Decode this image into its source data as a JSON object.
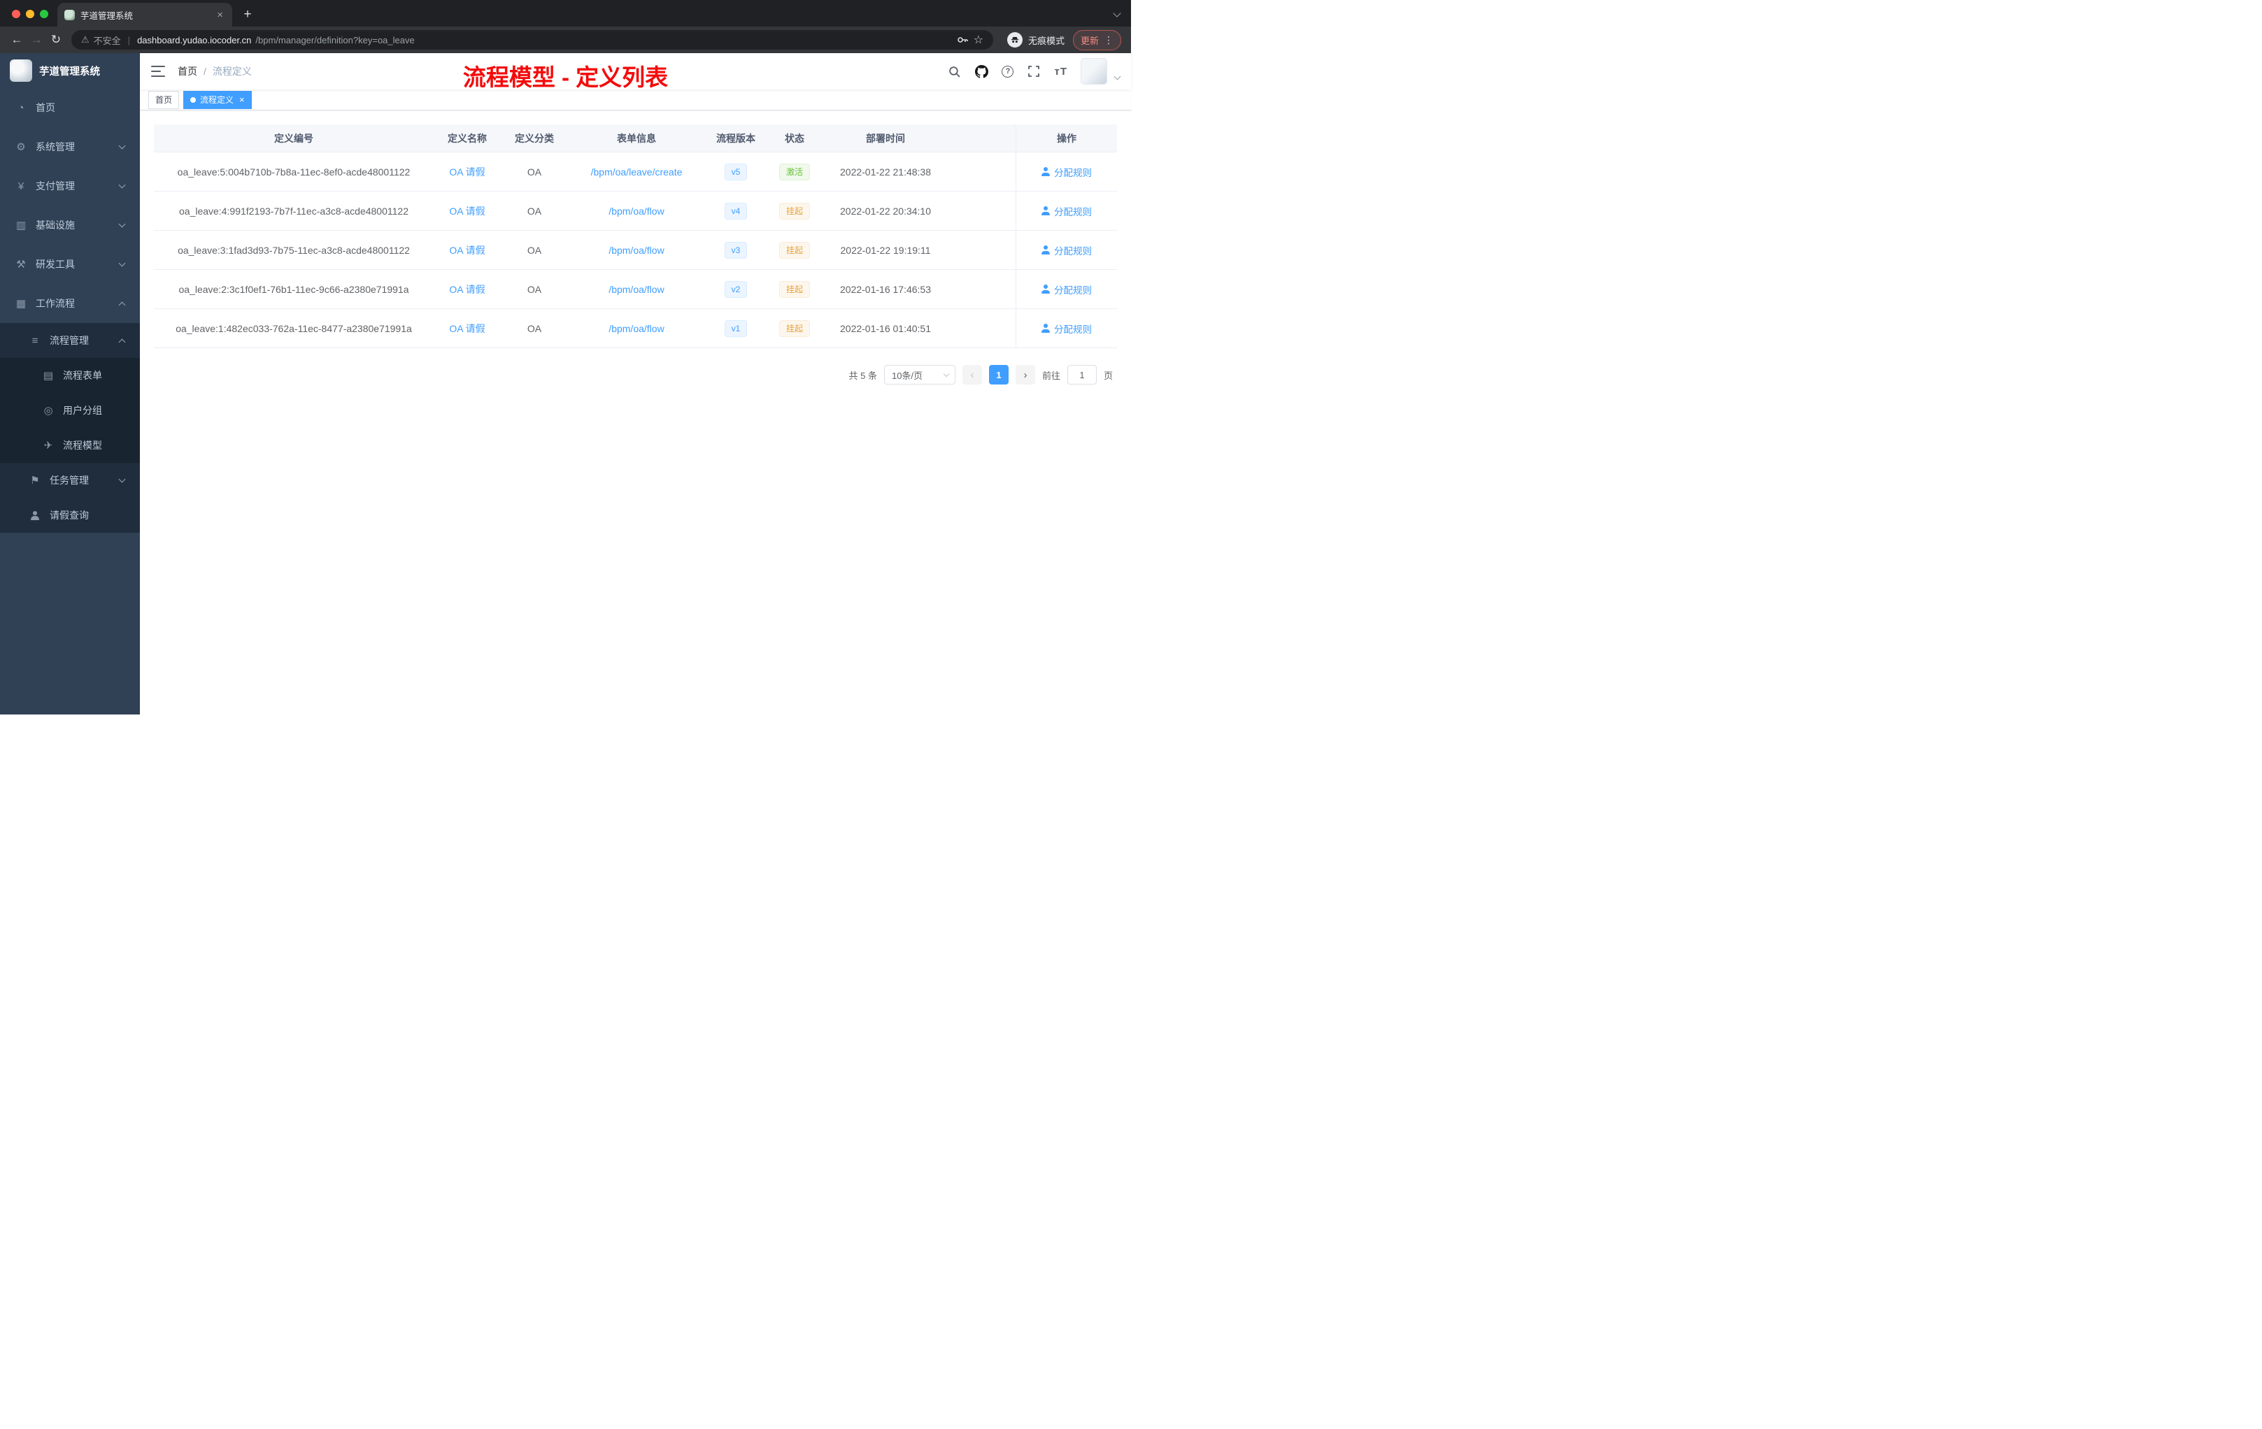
{
  "colors": {
    "accent": "#409eff",
    "success": "#67c23a",
    "warning": "#e6a23c",
    "annotation_red": "#f40b0b",
    "sidebar_bg": "#304156"
  },
  "browser": {
    "tab_title": "芋道管理系统",
    "security_label": "不安全",
    "url_host": "dashboard.yudao.iocoder.cn",
    "url_path": "/bpm/manager/definition?key=oa_leave",
    "incognito_label": "无痕模式",
    "update_label": "更新"
  },
  "sidebar": {
    "logo_title": "芋道管理系统",
    "items": [
      {
        "key": "home",
        "label": "首页",
        "icon": "dashboard",
        "glyph": "◔",
        "level": 1
      },
      {
        "key": "system",
        "label": "系统管理",
        "icon": "gear",
        "glyph": "⚙",
        "level": 1,
        "chevron": "down"
      },
      {
        "key": "payment",
        "label": "支付管理",
        "icon": "yen",
        "glyph": "¥",
        "level": 1,
        "chevron": "down"
      },
      {
        "key": "infrastructure",
        "label": "基础设施",
        "icon": "monitor",
        "glyph": "▥",
        "level": 1,
        "chevron": "down"
      },
      {
        "key": "devtools",
        "label": "研发工具",
        "icon": "tools",
        "glyph": "⚒",
        "level": 1,
        "chevron": "down"
      },
      {
        "key": "workflow",
        "label": "工作流程",
        "icon": "cube",
        "glyph": "▦",
        "level": 1,
        "chevron": "up"
      },
      {
        "key": "process-mgmt",
        "label": "流程管理",
        "icon": "list",
        "glyph": "≡",
        "level": 2,
        "chevron": "up"
      },
      {
        "key": "process-form",
        "label": "流程表单",
        "icon": "document",
        "glyph": "▤",
        "level": 3
      },
      {
        "key": "user-group",
        "label": "用户分组",
        "icon": "users",
        "glyph": "◎",
        "level": 3
      },
      {
        "key": "process-model",
        "label": "流程模型",
        "icon": "send",
        "glyph": "✈",
        "level": 3
      },
      {
        "key": "task-mgmt",
        "label": "任务管理",
        "icon": "task",
        "glyph": "⚑",
        "level": 2,
        "chevron": "down"
      },
      {
        "key": "leave-query",
        "label": "请假查询",
        "icon": "person",
        "glyph": "person",
        "level": 2
      }
    ]
  },
  "navbar": {
    "breadcrumb_home": "首页",
    "breadcrumb_sep": "/",
    "breadcrumb_current": "流程定义",
    "font_icon_text": "тT",
    "annotation": "流程模型 - 定义列表"
  },
  "tags": [
    {
      "label": "首页",
      "active": false,
      "closable": false
    },
    {
      "label": "流程定义",
      "active": true,
      "closable": true
    }
  ],
  "table": {
    "columns": [
      "定义编号",
      "定义名称",
      "定义分类",
      "表单信息",
      "流程版本",
      "状态",
      "部署时间",
      "操作"
    ],
    "rows": [
      {
        "id": "oa_leave:5:004b710b-7b8a-11ec-8ef0-acde48001122",
        "name": "OA 请假",
        "category": "OA",
        "form": "/bpm/oa/leave/create",
        "version": "v5",
        "status": "激活",
        "status_type": "success",
        "time": "2022-01-22 21:48:38",
        "action": "分配规则"
      },
      {
        "id": "oa_leave:4:991f2193-7b7f-11ec-a3c8-acde48001122",
        "name": "OA 请假",
        "category": "OA",
        "form": "/bpm/oa/flow",
        "version": "v4",
        "status": "挂起",
        "status_type": "warning",
        "time": "2022-01-22 20:34:10",
        "action": "分配规则"
      },
      {
        "id": "oa_leave:3:1fad3d93-7b75-11ec-a3c8-acde48001122",
        "name": "OA 请假",
        "category": "OA",
        "form": "/bpm/oa/flow",
        "version": "v3",
        "status": "挂起",
        "status_type": "warning",
        "time": "2022-01-22 19:19:11",
        "action": "分配规则"
      },
      {
        "id": "oa_leave:2:3c1f0ef1-76b1-11ec-9c66-a2380e71991a",
        "name": "OA 请假",
        "category": "OA",
        "form": "/bpm/oa/flow",
        "version": "v2",
        "status": "挂起",
        "status_type": "warning",
        "time": "2022-01-16 17:46:53",
        "action": "分配规则"
      },
      {
        "id": "oa_leave:1:482ec033-762a-11ec-8477-a2380e71991a",
        "name": "OA 请假",
        "category": "OA",
        "form": "/bpm/oa/flow",
        "version": "v1",
        "status": "挂起",
        "status_type": "warning",
        "time": "2022-01-16 01:40:51",
        "action": "分配规则"
      }
    ]
  },
  "pagination": {
    "total": "共 5 条",
    "page_size": "10条/页",
    "prev": "‹",
    "current_page": "1",
    "next": "›",
    "goto_label": "前往",
    "goto_value": "1",
    "unit_label": "页"
  }
}
